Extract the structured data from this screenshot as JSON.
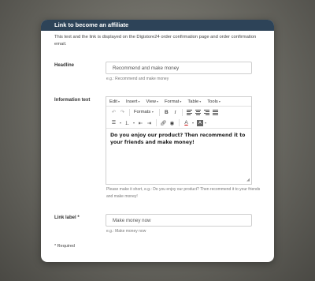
{
  "panel": {
    "title": "Link to become an affiliate",
    "intro": "This text and the link is displayed on the Digistore24 order confirmation page and order confirmation email."
  },
  "headline": {
    "label": "Headline",
    "value": "Recommend and make money",
    "hint": "e.g.: Recommend and make money"
  },
  "information": {
    "label": "Information text",
    "menu": [
      "Edit",
      "Insert",
      "View",
      "Format",
      "Table",
      "Tools"
    ],
    "formats_label": "Formats",
    "content": "Do you enjoy our product? Then recommend it to your friends and make money!",
    "hint": "Please make it short, e.g.: Do you enjoy our product? Then recommend it to your friends and make money!"
  },
  "link_label": {
    "label": "Link label *",
    "value": "Make money now",
    "hint": "e.g.: Make money now"
  },
  "required_note": "* Required",
  "colors": {
    "header_bg": "#2d4358",
    "panel_bg": "#ffffff"
  }
}
